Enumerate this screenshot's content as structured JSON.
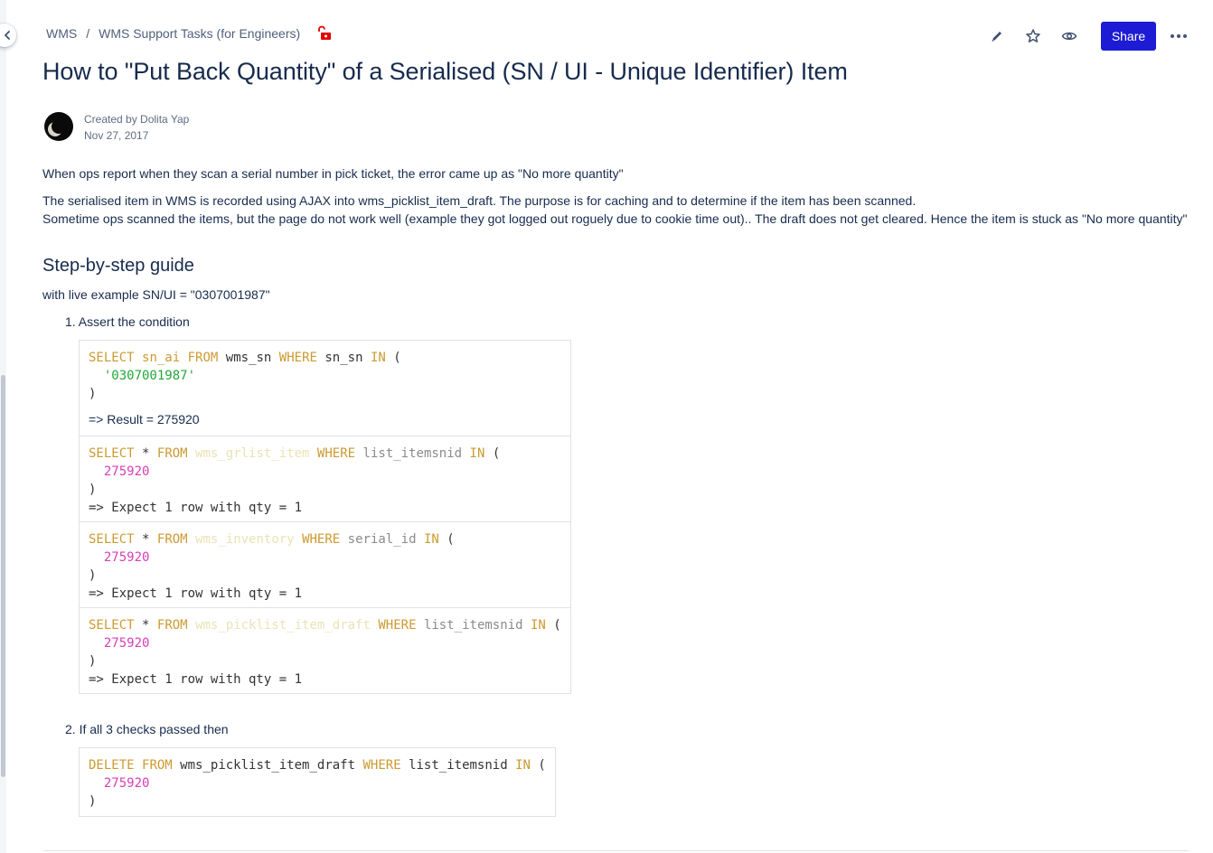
{
  "breadcrumb": {
    "space": "WMS",
    "separator": "/",
    "parent": "WMS Support Tasks (for Engineers)"
  },
  "toolbar": {
    "share_label": "Share",
    "icons": [
      "edit-icon",
      "star-icon",
      "watch-icon",
      "more-icon"
    ]
  },
  "page": {
    "title": "How to \"Put Back Quantity\" of a Serialised (SN / UI - Unique Identifier) Item",
    "created_by": "Created by Dolita Yap",
    "created_date": "Nov 27, 2017"
  },
  "body": {
    "p1": "When ops report when they scan a serial number in pick ticket, the error came up as \"No more quantity\"",
    "p2": "The serialised item in WMS is recorded using AJAX into wms_picklist_item_draft. The purpose is for caching and to determine if the item has been scanned.",
    "p3": "Sometime ops scanned the items, but the page do not work well (example they got logged out roguely due to cookie time out).. The draft does not get cleared. Hence the item is stuck as \"No more quantity\"",
    "heading": "Step-by-step guide",
    "example": "with live example SN/UI = \"0307001987\"",
    "step1": "1. Assert the condition",
    "step2": "2. If all 3 checks passed then"
  },
  "code": {
    "select": "SELECT",
    "star": "*",
    "from": "FROM",
    "where": "WHERE",
    "in": "IN",
    "delete": "DELETE",
    "open": "(",
    "close": ")",
    "q1": {
      "col": "sn_ai",
      "table": "wms_sn",
      "key": "sn_sn",
      "value": "'0307001987'",
      "result": "=> Result = 275920"
    },
    "q2": {
      "table": "wms_grlist_item",
      "key": "list_itemsnid",
      "value": "275920",
      "expect": "=> Expect 1 row with qty = 1"
    },
    "q3": {
      "table": "wms_inventory",
      "key": "serial_id",
      "value": "275920",
      "expect": "=> Expect 1 row with qty = 1"
    },
    "q4": {
      "table": "wms_picklist_item_draft",
      "key": "list_itemsnid",
      "value": "275920",
      "expect": "=> Expect 1 row with qty = 1"
    },
    "q5": {
      "table": "wms_picklist_item_draft",
      "key": "list_itemsnid",
      "value": "275920"
    }
  },
  "colors": {
    "share_bg": "#1d1bd4",
    "keyword": "#cc9a31",
    "string": "#22a837",
    "number": "#d63fb6",
    "lock_red": "#e00000"
  }
}
